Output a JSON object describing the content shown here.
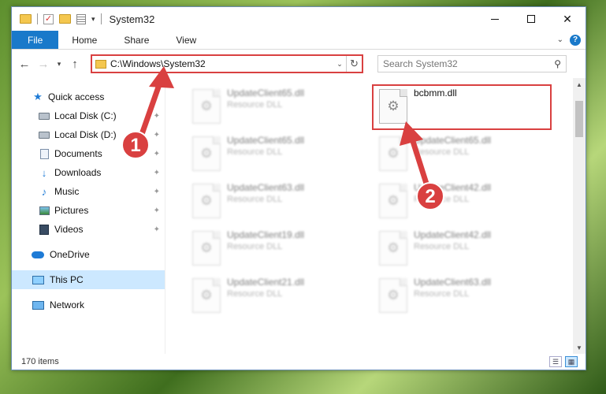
{
  "window": {
    "title": "System32"
  },
  "ribbon": {
    "tabs": [
      "File",
      "Home",
      "Share",
      "View"
    ],
    "help_label": "?"
  },
  "navbar": {
    "back_icon": "back-arrow-icon",
    "forward_icon": "forward-arrow-icon",
    "up_icon": "up-arrow-icon",
    "address": "C:\\Windows\\System32",
    "search_placeholder": "Search System32"
  },
  "sidebar": {
    "items": [
      {
        "label": "Quick access",
        "icon": "star-icon",
        "pinned": false
      },
      {
        "label": "Local Disk (C:)",
        "icon": "drive-icon",
        "pinned": true
      },
      {
        "label": "Local Disk (D:)",
        "icon": "drive-icon",
        "pinned": true
      },
      {
        "label": "Documents",
        "icon": "documents-icon",
        "pinned": true
      },
      {
        "label": "Downloads",
        "icon": "download-icon",
        "pinned": true
      },
      {
        "label": "Music",
        "icon": "music-icon",
        "pinned": true
      },
      {
        "label": "Pictures",
        "icon": "pictures-icon",
        "pinned": true
      },
      {
        "label": "Videos",
        "icon": "videos-icon",
        "pinned": true
      },
      {
        "label": "OneDrive",
        "icon": "cloud-icon",
        "pinned": false
      },
      {
        "label": "This PC",
        "icon": "computer-icon",
        "pinned": false,
        "selected": true
      },
      {
        "label": "Network",
        "icon": "network-icon",
        "pinned": false
      }
    ]
  },
  "files": {
    "left": [
      {
        "name": "UpdateClient65.dll",
        "type": "Resource DLL"
      },
      {
        "name": "UpdateClient65.dll",
        "type": "Resource DLL"
      },
      {
        "name": "UpdateClient63.dll",
        "type": "Resource DLL"
      },
      {
        "name": "UpdateClient19.dll",
        "type": "Resource DLL"
      },
      {
        "name": "UpdateClient21.dll",
        "type": "Resource DLL"
      }
    ],
    "right": [
      {
        "name": "bcbmm.dll",
        "type": ""
      },
      {
        "name": "UpdateClient65.dll",
        "type": "Resource DLL"
      },
      {
        "name": "UpdateClient42.dll",
        "type": "Resource DLL"
      },
      {
        "name": "UpdateClient42.dll",
        "type": "Resource DLL"
      },
      {
        "name": "UpdateClient63.dll",
        "type": "Resource DLL"
      }
    ]
  },
  "status": {
    "item_count": "170 items"
  },
  "annotations": {
    "step1": "1",
    "step2": "2",
    "color": "#d94040"
  },
  "colors": {
    "accent": "#1979ca",
    "highlight": "#d94040",
    "selection": "#cce8ff"
  }
}
